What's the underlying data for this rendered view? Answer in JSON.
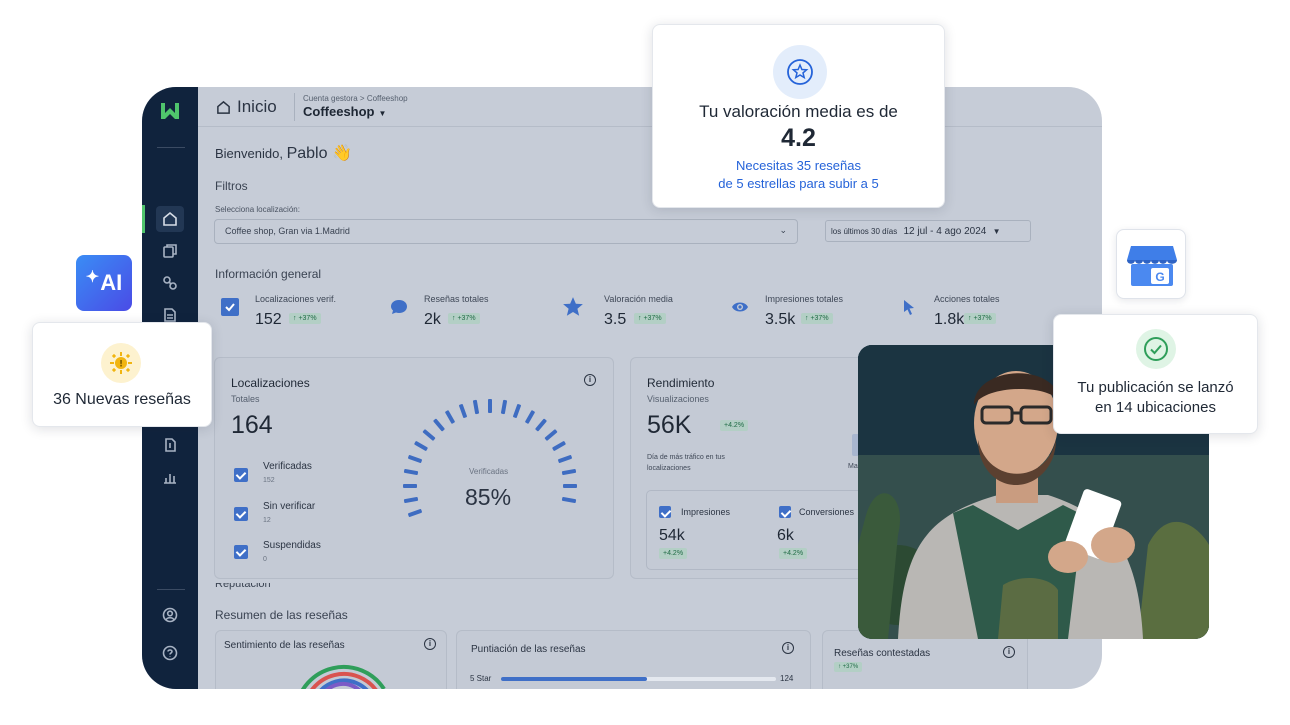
{
  "topbar": {
    "home_label": "Inicio",
    "breadcrumb": "Cuenta gestora > Coffeeshop",
    "store_name": "Coffeeshop"
  },
  "welcome": {
    "greeting": "Bienvenido,",
    "name": "Pablo 👋"
  },
  "filters": {
    "title": "Filtros",
    "location_label": "Selecciona localización:",
    "location_value": "Coffee shop, Gran via 1.Madrid",
    "date_prefix": "los últimos 30 días",
    "date_range": "12 jul - 4 ago 2024"
  },
  "general": {
    "title": "Información general",
    "kpis": [
      {
        "label": "Localizaciones verif.",
        "value": "152",
        "delta": "↑ +37%",
        "icon": "checkbox-icon"
      },
      {
        "label": "Reseñas totales",
        "value": "2k",
        "delta": "↑ +37%",
        "icon": "chat-bubble-icon"
      },
      {
        "label": "Valoración media",
        "value": "3.5",
        "delta": "↑ +37%",
        "icon": "star-icon"
      },
      {
        "label": "Impresiones totales",
        "value": "3.5k",
        "delta": "↑ +37%",
        "icon": "eye-icon"
      },
      {
        "label": "Acciones totales",
        "value": "1.8k",
        "delta": "↑ +37%",
        "icon": "cursor-icon"
      }
    ]
  },
  "locations_card": {
    "title": "Localizaciones",
    "subtitle": "Totales",
    "total": "164",
    "gauge_label": "Verificadas",
    "gauge_percent": "85%",
    "gauge_fraction": 0.85,
    "items": [
      {
        "label": "Verificadas",
        "value": "152"
      },
      {
        "label": "Sin verificar",
        "value": "12"
      },
      {
        "label": "Suspendidas",
        "value": "0"
      }
    ]
  },
  "performance_card": {
    "title": "Rendimiento",
    "subtitle": "Visualizaciones",
    "value": "56K",
    "delta": "+4.2%",
    "note_line1": "Día de más tráfico en tus",
    "note_line2": "localizaciones",
    "partial_label": "Ma",
    "metrics": [
      {
        "label": "Impresiones",
        "value": "54k",
        "delta": "+4.2%"
      },
      {
        "label": "Conversiones",
        "value": "6k",
        "delta": "+4.2%"
      }
    ]
  },
  "reputation": {
    "section_title": "Reputación",
    "summary_title": "Resumen de las reseñas",
    "sentiment_title": "Sentimiento de las reseñas",
    "score_title": "Puntiación de las reseñas",
    "score_row_label": "5 Star",
    "score_row_value": "124",
    "score_row_fraction": 0.53,
    "answered_title": "Reseñas contestadas",
    "answered_delta": "↑ +37%"
  },
  "floating": {
    "rating_line1": "Tu valoración media es de",
    "rating_value": "4.2",
    "rating_hint_line1": "Necesitas 35 reseñas",
    "rating_hint_line2": "de 5 estrellas para subir a 5",
    "new_reviews": "36 Nuevas reseñas",
    "ai_label": "AI",
    "launch_line1": "Tu publicación se lanzó",
    "launch_line2": "en 14 ubicaciones"
  },
  "colors": {
    "sidebar": "#10233d",
    "overlay": "#c6ccd7",
    "accent_blue": "#2563d9",
    "brand_green": "#4fc46c"
  }
}
